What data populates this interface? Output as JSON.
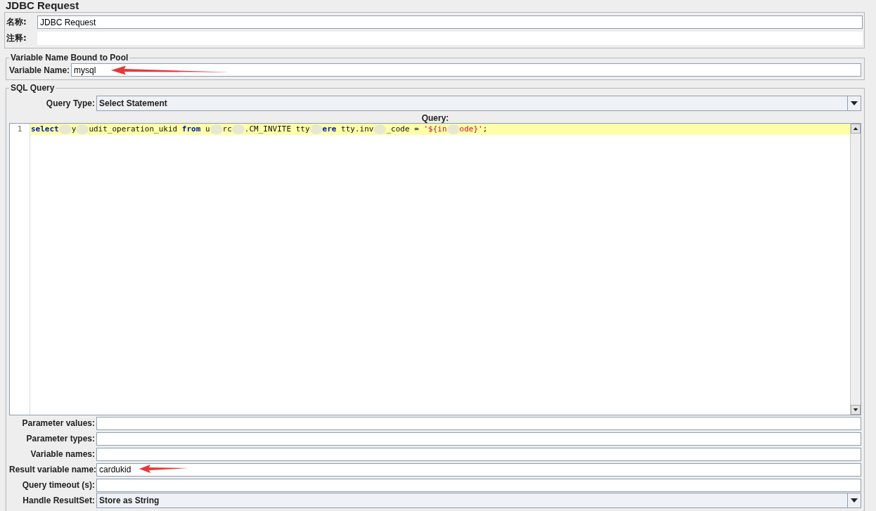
{
  "title": "JDBC Request",
  "name_field": {
    "label": "名称:",
    "value": "JDBC Request"
  },
  "comment_field": {
    "label": "注释:"
  },
  "pool": {
    "legend": "Variable Name Bound to Pool",
    "label": "Variable Name:",
    "value": "mysql",
    "annotated": true
  },
  "sql": {
    "legend": "SQL Query",
    "query_type": {
      "label": "Query Type:",
      "value": "Select Statement"
    },
    "query_label": "Query:",
    "lines": [
      {
        "number": "1",
        "highlighted": true,
        "tokens": [
          {
            "kind": "keyword",
            "text": "select"
          },
          {
            "kind": "blur"
          },
          {
            "kind": "plain",
            "text": "y"
          },
          {
            "kind": "blur"
          },
          {
            "kind": "plain",
            "text": "udit_operation_ukid "
          },
          {
            "kind": "keyword",
            "text": "from"
          },
          {
            "kind": "plain",
            "text": " u"
          },
          {
            "kind": "blur"
          },
          {
            "kind": "plain",
            "text": "rc"
          },
          {
            "kind": "blur"
          },
          {
            "kind": "plain",
            "text": ".CM_INVITE tty"
          },
          {
            "kind": "blur"
          },
          {
            "kind": "keyword",
            "text": "ere"
          },
          {
            "kind": "plain",
            "text": " tty.inv"
          },
          {
            "kind": "blur"
          },
          {
            "kind": "plain",
            "text": "_code = "
          },
          {
            "kind": "string",
            "text": "'${in"
          },
          {
            "kind": "blur"
          },
          {
            "kind": "string",
            "text": "ode}'"
          },
          {
            "kind": "plain",
            "text": ";"
          }
        ]
      }
    ]
  },
  "fields": [
    {
      "label": "Parameter values:",
      "annotated": false
    },
    {
      "label": "Parameter types:",
      "annotated": false
    },
    {
      "label": "Variable names:",
      "annotated": false
    },
    {
      "label": "Result variable name:",
      "value": "cardukid",
      "annotated": true
    },
    {
      "label": "Query timeout (s):",
      "annotated": false
    }
  ],
  "result_set": {
    "label": "Handle ResultSet:",
    "value": "Store as String"
  }
}
